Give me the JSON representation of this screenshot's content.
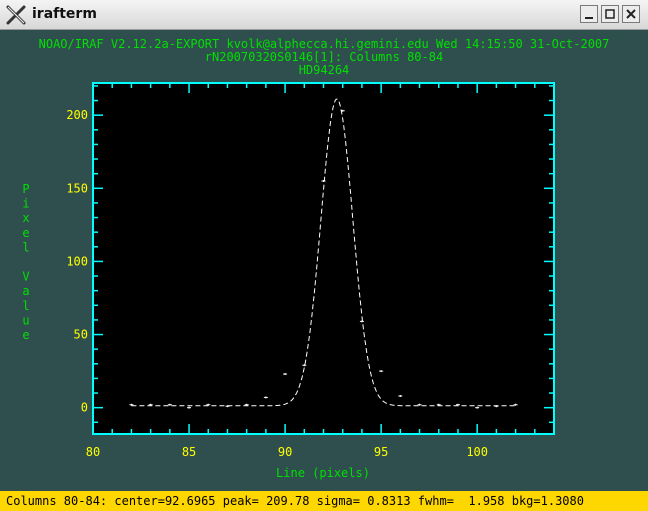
{
  "window": {
    "title": "irafterm",
    "app_icon": "x-logo-icon",
    "controls": [
      "minimize-icon",
      "maximize-icon",
      "close-icon"
    ]
  },
  "header": {
    "line1": "NOAO/IRAF V2.12.2a-EXPORT kvolk@alphecca.hi.gemini.edu Wed 14:15:50 31-Oct-2007",
    "line2": "rN20070320S0146[1]: Columns 80-84",
    "line3": "HD94264"
  },
  "colors": {
    "background": "#2f4f4f",
    "header_text": "#00e000",
    "axis_frame": "#00ffff",
    "tick_labels": "#ffff00",
    "plot_bg": "#000000",
    "data": "#ffffff",
    "status_bg": "#ffd700"
  },
  "chart_data": {
    "type": "scatter",
    "xlabel": "Line (pixels)",
    "ylabel": "Pixel Value",
    "xlim": [
      80,
      104
    ],
    "ylim": [
      -18,
      222
    ],
    "xticks": [
      80,
      85,
      90,
      95,
      100
    ],
    "yticks": [
      0,
      50,
      100,
      150,
      200
    ],
    "grid": false,
    "points": {
      "x": [
        82,
        83,
        84,
        85,
        86,
        87,
        88,
        89,
        90,
        91,
        92,
        93,
        94,
        95,
        96,
        97,
        98,
        99,
        100,
        101,
        102
      ],
      "y": [
        2,
        2,
        2,
        0,
        2,
        1,
        2,
        7,
        23,
        29,
        155,
        203,
        59,
        25,
        8,
        2,
        2,
        2,
        0,
        1,
        2
      ]
    },
    "fit": {
      "model": "gaussian",
      "center": 92.6965,
      "peak": 209.78,
      "sigma": 0.8313,
      "bkg": 1.308
    }
  },
  "status_bar": {
    "text": "Columns 80-84: center=92.6965 peak= 209.78 sigma= 0.8313 fwhm=  1.958 bkg=1.3080"
  }
}
